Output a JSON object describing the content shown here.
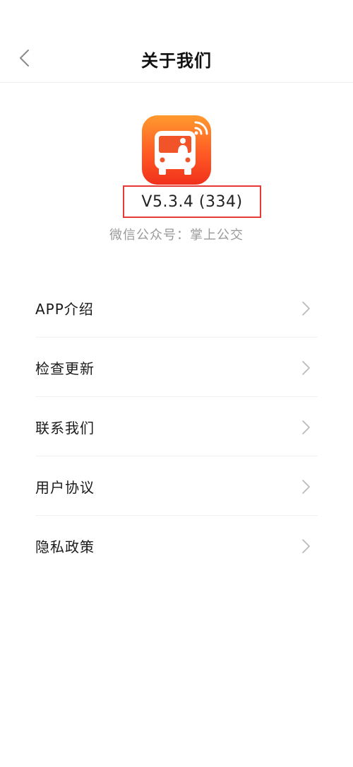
{
  "header": {
    "title": "关于我们",
    "back_icon": "chevron-left-icon"
  },
  "app": {
    "icon": "bus-app-icon",
    "version": "V5.3.4 (334)",
    "wechat": "微信公众号：掌上公交"
  },
  "menu": {
    "items": [
      {
        "label": "APP介绍",
        "icon": "chevron-right-icon"
      },
      {
        "label": "检查更新",
        "icon": "chevron-right-icon"
      },
      {
        "label": "联系我们",
        "icon": "chevron-right-icon"
      },
      {
        "label": "用户协议",
        "icon": "chevron-right-icon"
      },
      {
        "label": "隐私政策",
        "icon": "chevron-right-icon"
      }
    ]
  },
  "colors": {
    "highlight_box": "#e53935",
    "icon_gradient_top": "#ff9a2e",
    "icon_gradient_bottom": "#f0311c",
    "secondary_text": "#9a9a9a"
  }
}
